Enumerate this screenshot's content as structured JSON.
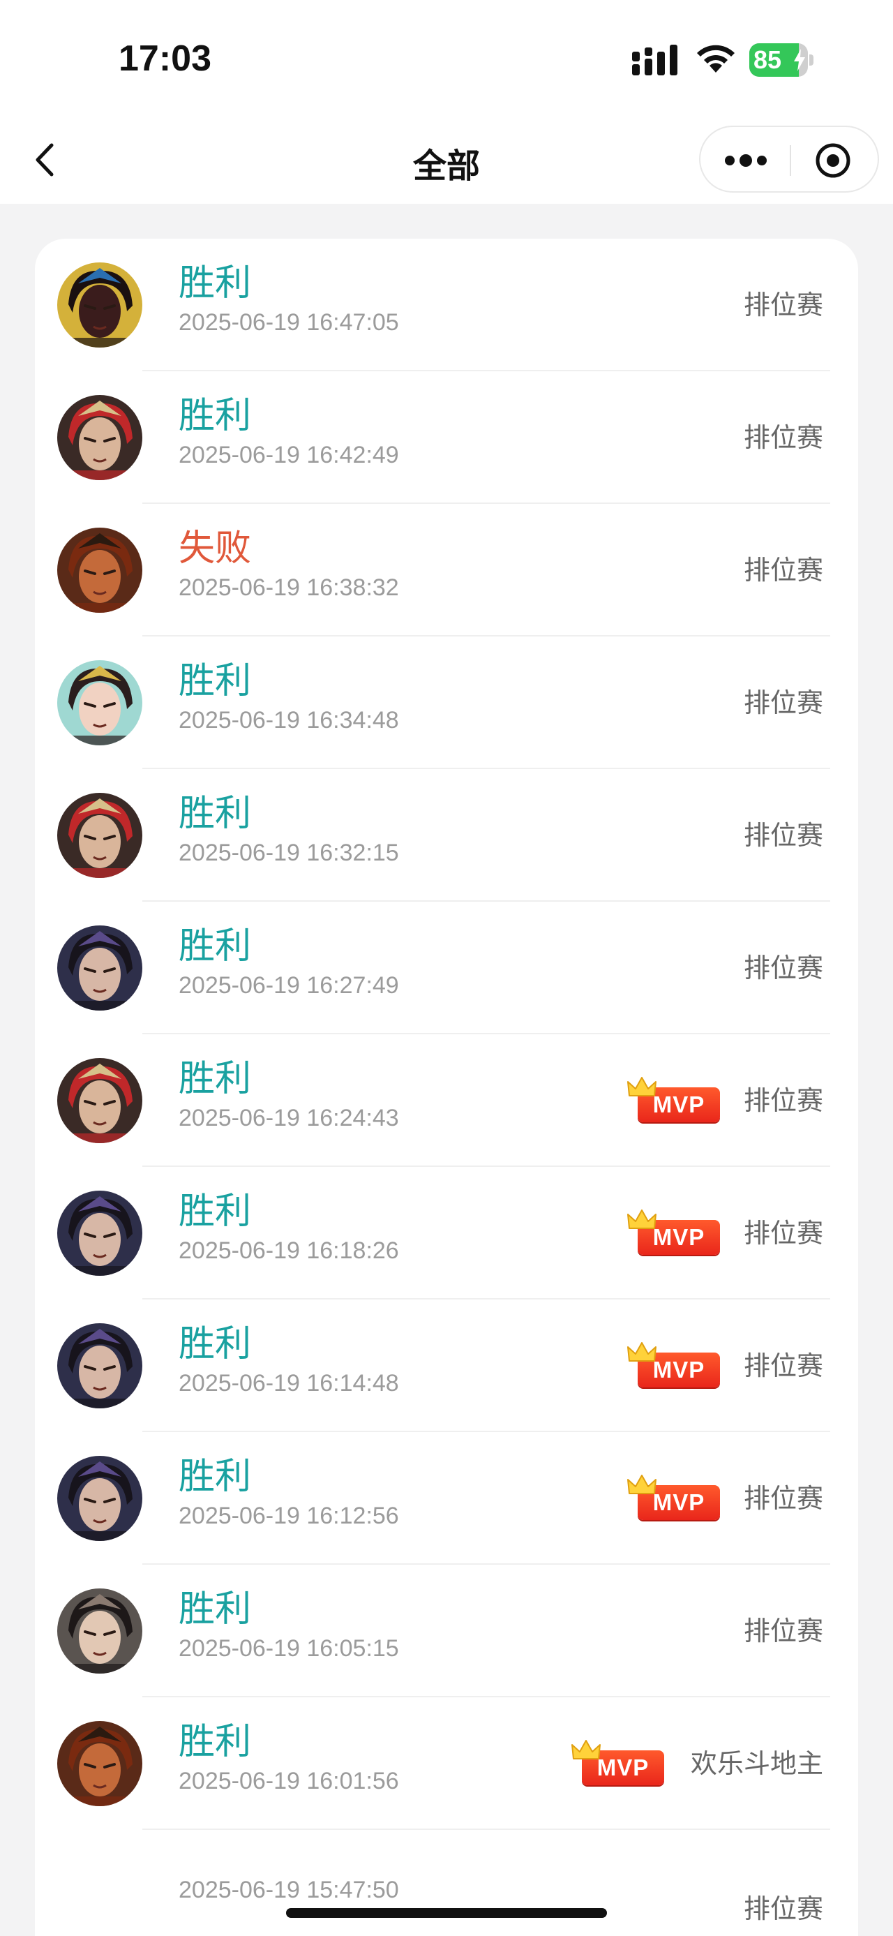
{
  "status_bar": {
    "time": "17:03",
    "battery_level": "85",
    "battery_fraction": 0.85
  },
  "nav": {
    "title": "全部",
    "back_icon": "chevron-left-icon",
    "more_icon": "more-dots-icon",
    "close_icon": "target-close-icon"
  },
  "colors": {
    "win": "#19a1a0",
    "lose": "#e0583a",
    "mvp": "#e9261b",
    "mode": "#666666",
    "time": "#9b9b9b"
  },
  "matches": [
    {
      "result": "胜利",
      "outcome": "win",
      "time": "2025-06-19 16:47:05",
      "mvp": false,
      "mode": "排位赛",
      "avatar": "hero-red-masked"
    },
    {
      "result": "胜利",
      "outcome": "win",
      "time": "2025-06-19 16:42:49",
      "mvp": false,
      "mode": "排位赛",
      "avatar": "hero-red-helmet"
    },
    {
      "result": "失败",
      "outcome": "lose",
      "time": "2025-06-19 16:38:32",
      "mvp": false,
      "mode": "排位赛",
      "avatar": "hero-angry-warrior"
    },
    {
      "result": "胜利",
      "outcome": "win",
      "time": "2025-06-19 16:34:48",
      "mvp": false,
      "mode": "排位赛",
      "avatar": "hero-crowned-lady"
    },
    {
      "result": "胜利",
      "outcome": "win",
      "time": "2025-06-19 16:32:15",
      "mvp": false,
      "mode": "排位赛",
      "avatar": "hero-red-helmet"
    },
    {
      "result": "胜利",
      "outcome": "win",
      "time": "2025-06-19 16:27:49",
      "mvp": false,
      "mode": "排位赛",
      "avatar": "hero-dark-hair"
    },
    {
      "result": "胜利",
      "outcome": "win",
      "time": "2025-06-19 16:24:43",
      "mvp": true,
      "mode": "排位赛",
      "avatar": "hero-red-helmet"
    },
    {
      "result": "胜利",
      "outcome": "win",
      "time": "2025-06-19 16:18:26",
      "mvp": true,
      "mode": "排位赛",
      "avatar": "hero-dark-hair"
    },
    {
      "result": "胜利",
      "outcome": "win",
      "time": "2025-06-19 16:14:48",
      "mvp": true,
      "mode": "排位赛",
      "avatar": "hero-dark-hair"
    },
    {
      "result": "胜利",
      "outcome": "win",
      "time": "2025-06-19 16:12:56",
      "mvp": true,
      "mode": "排位赛",
      "avatar": "hero-dark-hair"
    },
    {
      "result": "胜利",
      "outcome": "win",
      "time": "2025-06-19 16:05:15",
      "mvp": false,
      "mode": "排位赛",
      "avatar": "hero-long-hair"
    },
    {
      "result": "胜利",
      "outcome": "win",
      "time": "2025-06-19 16:01:56",
      "mvp": true,
      "mode": "欢乐斗地主",
      "avatar": "hero-angry-warrior"
    },
    {
      "result": "",
      "outcome": "none",
      "time": "2025-06-19 15:47:50",
      "mvp": false,
      "mode": "排位赛",
      "avatar": "none"
    }
  ],
  "mvp_label": "MVP"
}
